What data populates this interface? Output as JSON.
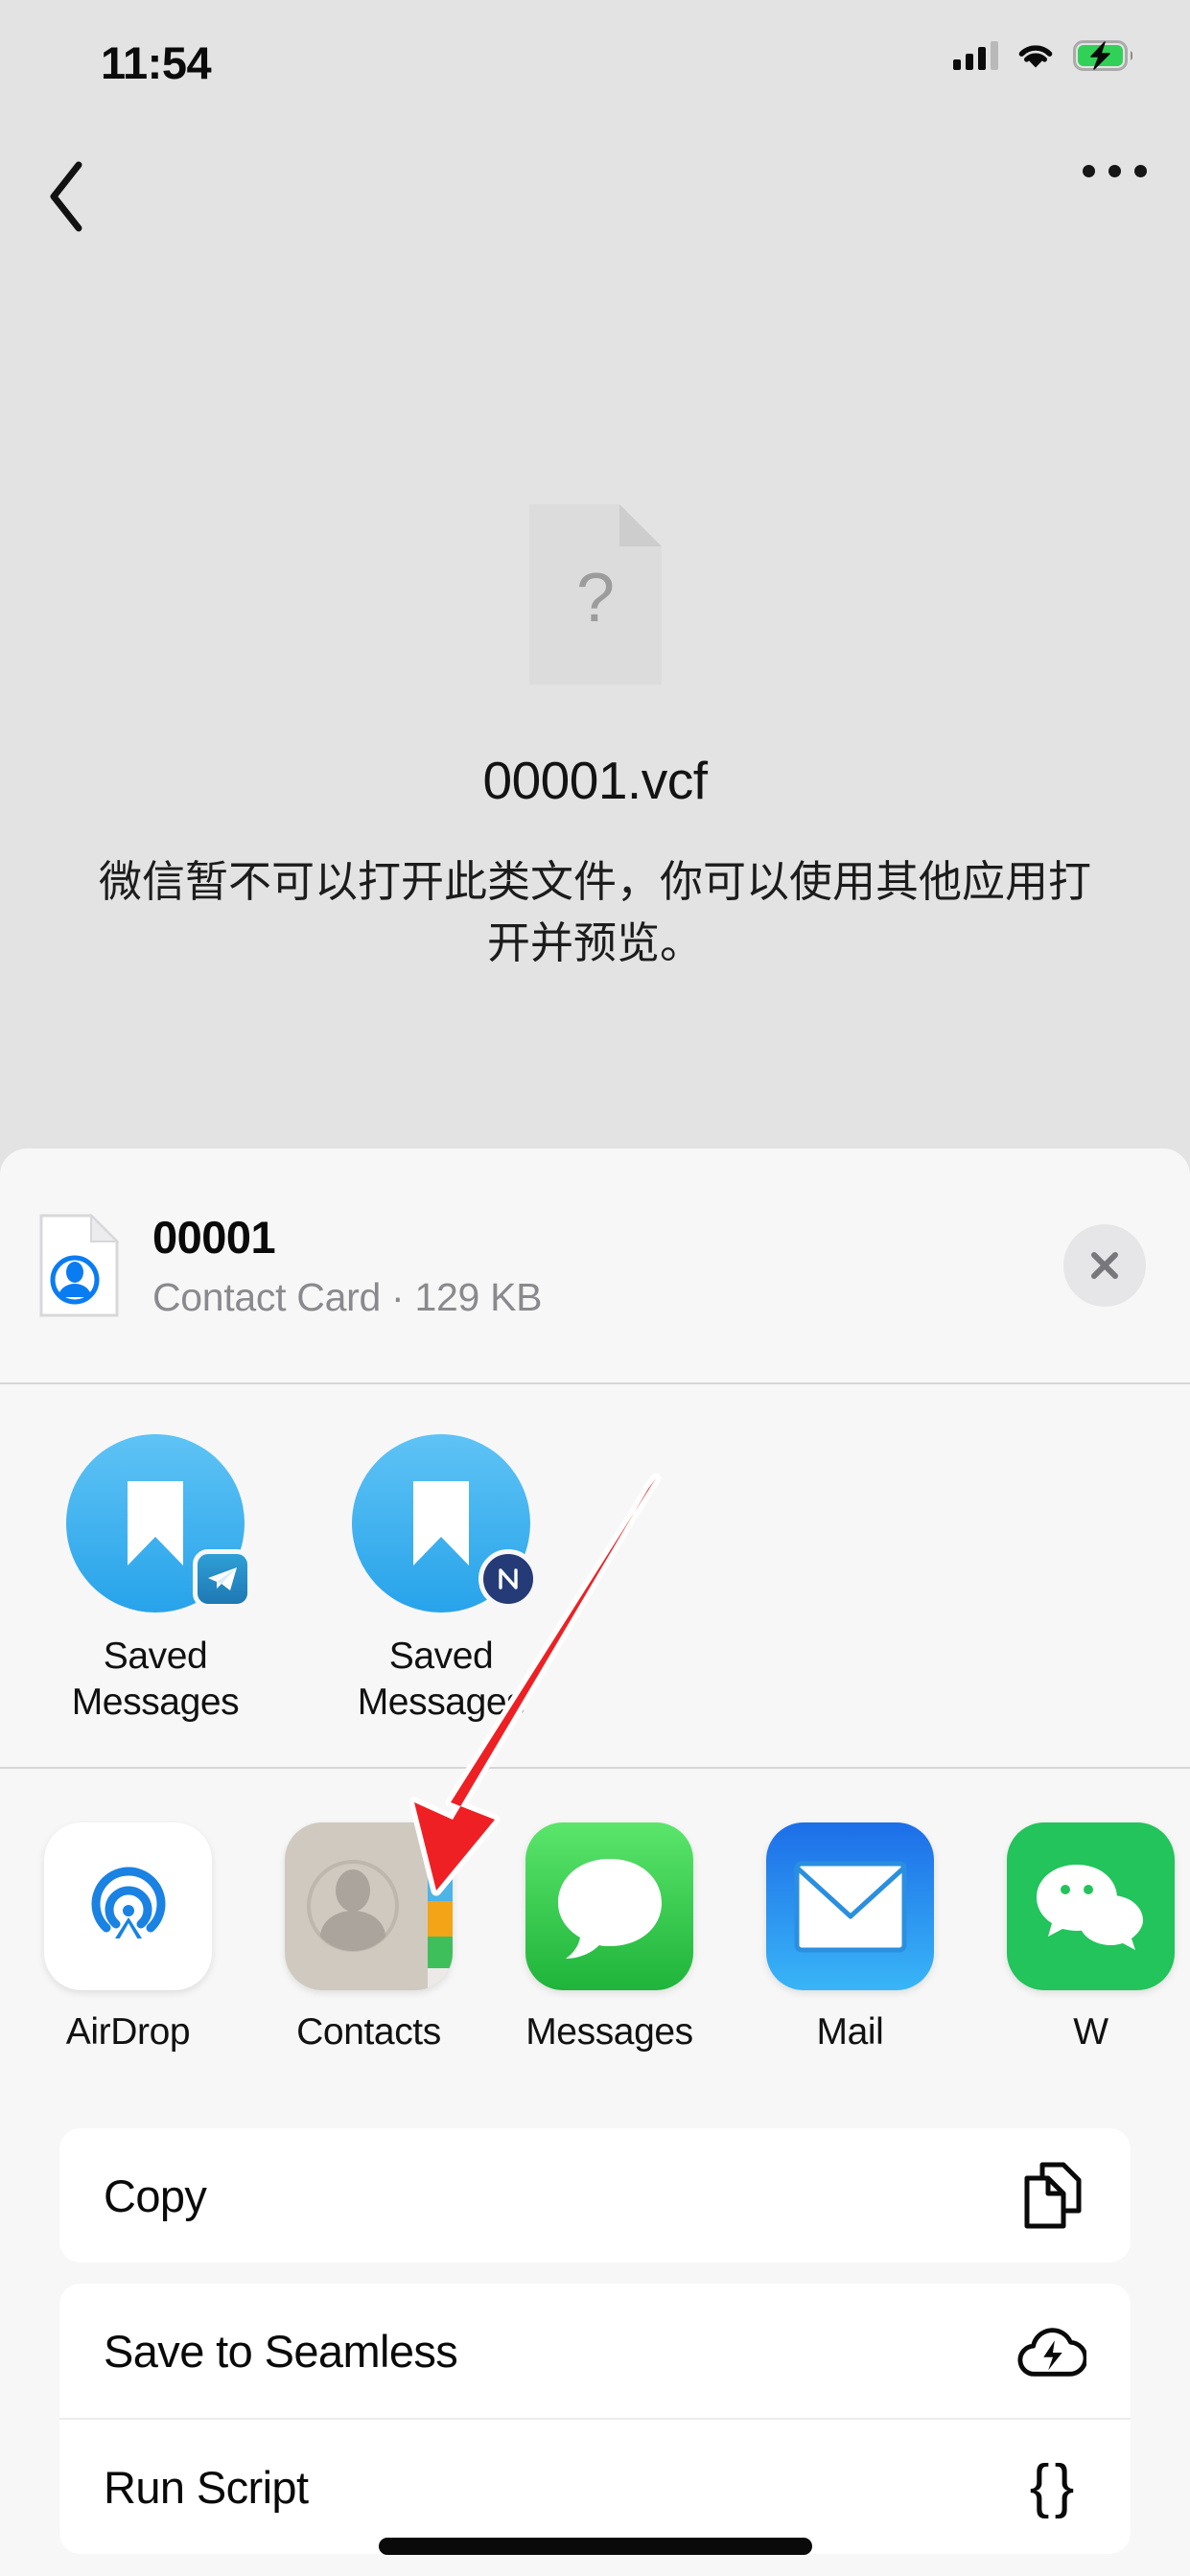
{
  "status_bar": {
    "time": "11:54",
    "signal_icon": "cellular-signal-icon",
    "wifi_icon": "wifi-icon",
    "battery_icon": "battery-charging-icon",
    "battery_charging": true,
    "signal_bars_filled": 3,
    "signal_bars_total": 4
  },
  "nav_bar": {
    "back_icon": "chevron-left-icon",
    "more_icon": "more-horizontal-icon"
  },
  "file_preview": {
    "icon": "unknown-document-icon",
    "icon_glyph": "?",
    "file_name": "00001.vcf",
    "message": "微信暂不可以打开此类文件，你可以使用其他应用打开并预览。"
  },
  "share_sheet": {
    "header": {
      "icon": "contact-card-file-icon",
      "title": "00001",
      "subtitle": "Contact Card · 129 KB",
      "close_icon": "close-icon"
    },
    "contacts": [
      {
        "name": "Saved\nMessages",
        "line1": "Saved",
        "line2": "Messages",
        "avatar_icon": "bookmark-icon",
        "badge_app": "telegram-badge-icon"
      },
      {
        "name": "Saved\nMessages",
        "line1": "Saved",
        "line2": "Messages",
        "avatar_icon": "bookmark-icon",
        "badge_app": "nicegram-badge-icon"
      }
    ],
    "apps": [
      {
        "label": "AirDrop",
        "icon": "airdrop-icon"
      },
      {
        "label": "Contacts",
        "icon": "contacts-app-icon"
      },
      {
        "label": "Messages",
        "icon": "messages-app-icon"
      },
      {
        "label": "Mail",
        "icon": "mail-app-icon"
      },
      {
        "label": "W",
        "icon": "wechat-app-icon"
      }
    ],
    "actions": [
      {
        "label": "Copy",
        "icon": "copy-documents-icon"
      },
      {
        "label": "Save to Seamless",
        "icon": "cloud-bolt-icon"
      },
      {
        "label": "Run Script",
        "icon": "curly-braces-icon"
      }
    ]
  },
  "annotation": {
    "arrow_icon": "red-arrow-pointing-down-left",
    "arrow_color": "#ee2024",
    "arrow_outline_color": "#ffffff",
    "points_at": "contacts-app-icon"
  },
  "colors": {
    "page_background": "#e3e3e3",
    "sheet_background": "#f7f7f7",
    "card_background": "#ffffff",
    "divider": "#d6d6d8",
    "primary_text": "#0a0a0a",
    "secondary_text": "#8a8a8e",
    "accent_blue": "#27a3ea",
    "battery_green": "#31d158"
  },
  "home_indicator": {
    "visible": true
  }
}
